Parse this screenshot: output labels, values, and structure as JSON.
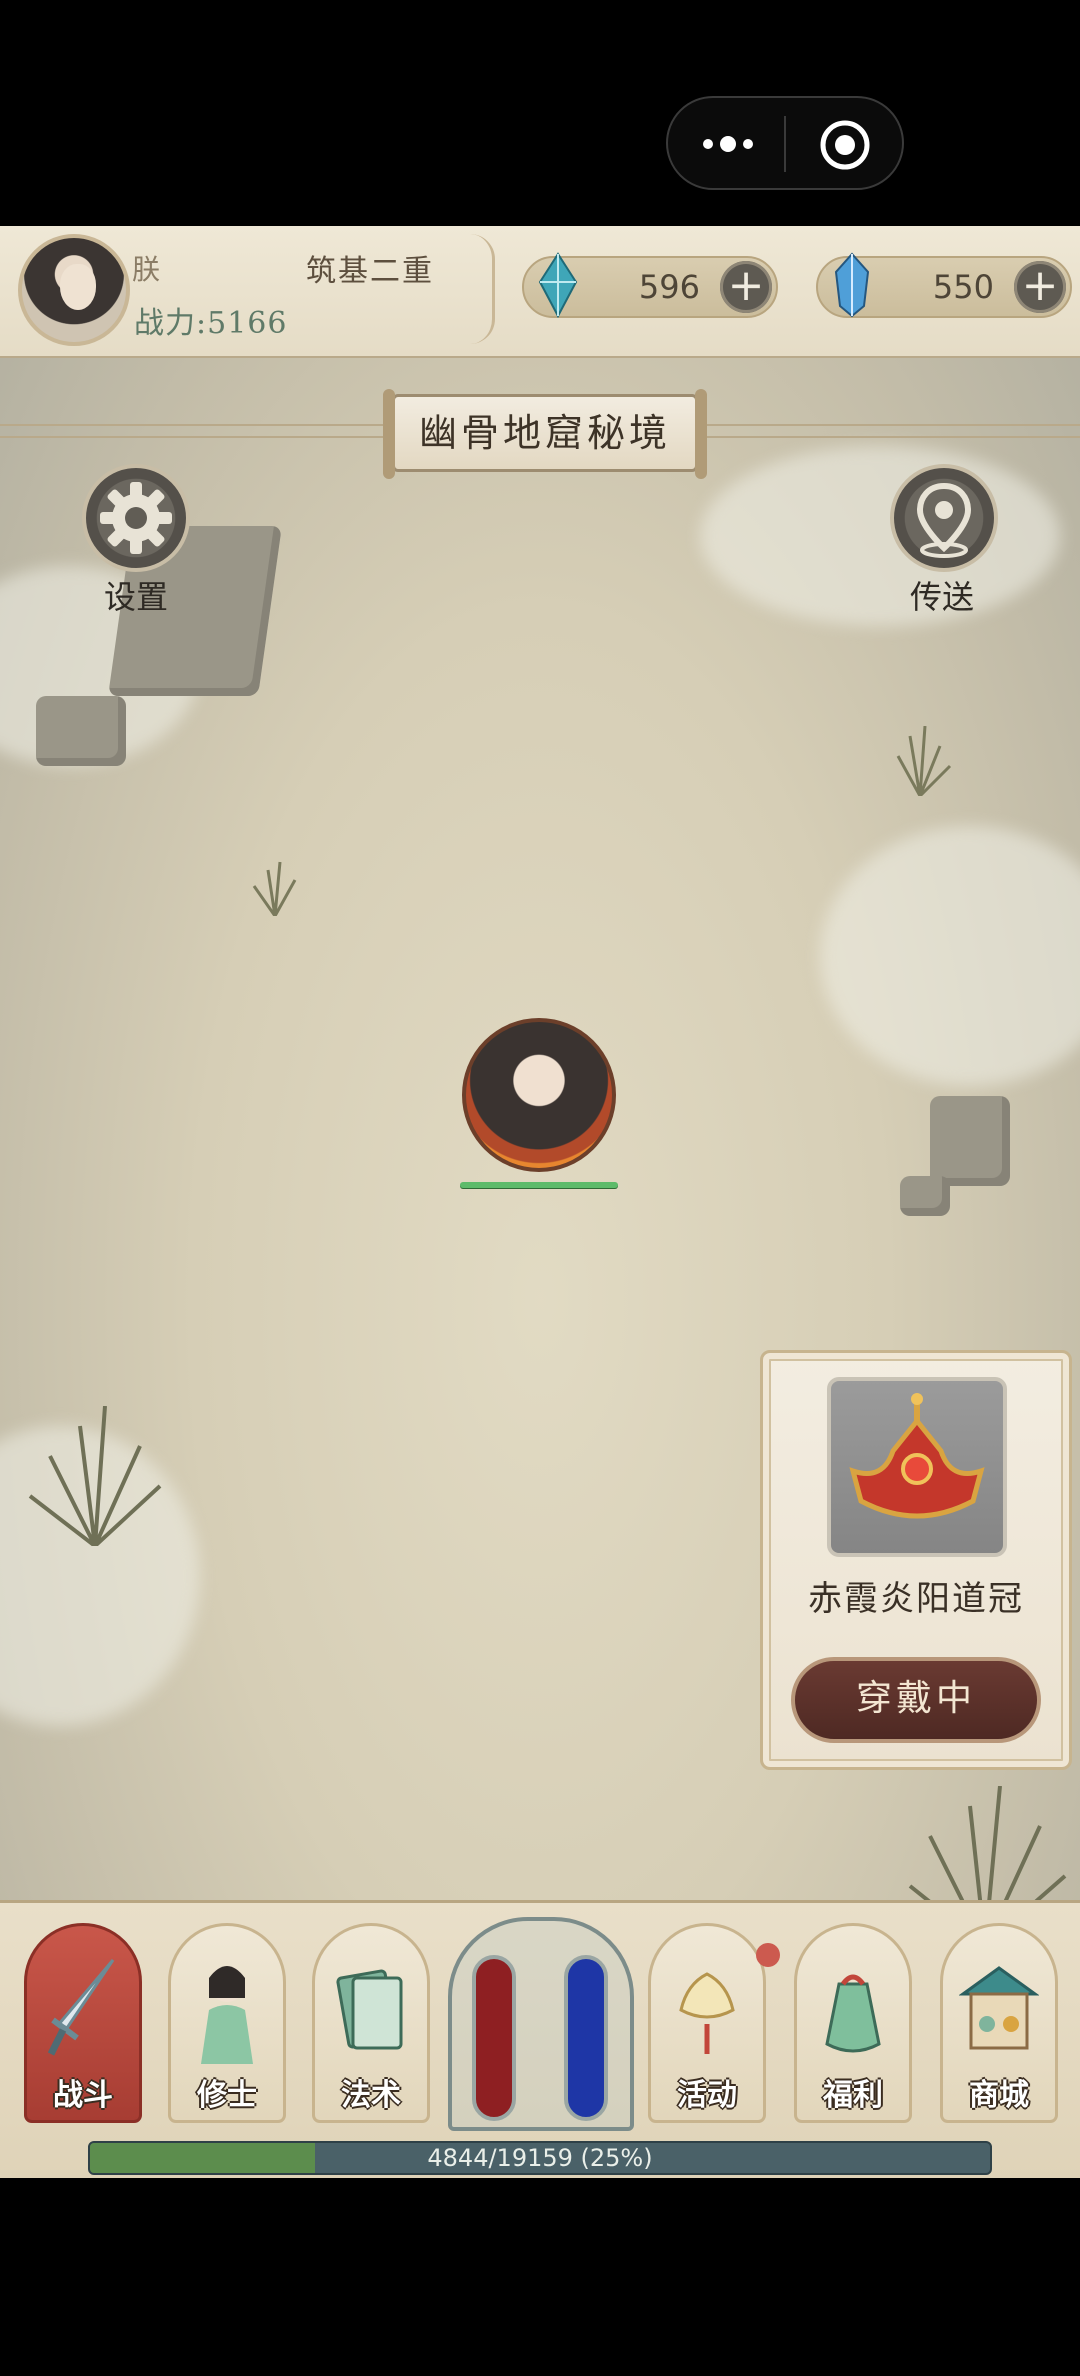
{
  "player": {
    "name": "朕",
    "realm": "筑基二重",
    "power_label": "战力:",
    "power_value": "5166"
  },
  "resources": [
    {
      "name": "spirit-stone",
      "value": "596",
      "color": "#3fa6b8"
    },
    {
      "name": "crystal",
      "value": "550",
      "color": "#4f9fd8"
    }
  ],
  "location": {
    "title": "幽骨地窟秘境"
  },
  "buttons": {
    "settings_label": "设置",
    "teleport_label": "传送"
  },
  "equipment": {
    "item_name": "赤霞炎阳道冠",
    "status_label": "穿戴中"
  },
  "hero": {
    "hp_fraction": 1.0
  },
  "nav": {
    "tabs": [
      {
        "key": "battle",
        "label": "战斗",
        "active": true
      },
      {
        "key": "cultivator",
        "label": "修士",
        "active": false
      },
      {
        "key": "spells",
        "label": "法术",
        "active": false
      },
      {
        "key": "events",
        "label": "活动",
        "active": false
      },
      {
        "key": "welfare",
        "label": "福利",
        "active": false
      },
      {
        "key": "shop",
        "label": "商城",
        "active": false
      }
    ],
    "hp_vial_color": "#8e1f22",
    "mp_vial_color": "#1e36a6"
  },
  "experience": {
    "current": 4844,
    "max": 19159,
    "percent": 25,
    "text": "4844/19159 (25%)"
  }
}
